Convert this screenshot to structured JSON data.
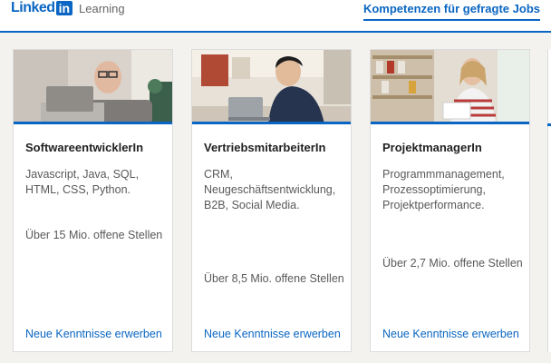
{
  "header": {
    "logo_text": "Linked",
    "logo_badge": "in",
    "product": "Learning",
    "nav_link": "Kompetenzen für gefragte Jobs",
    "accent_color": "#0a66c2"
  },
  "cards": [
    {
      "title": "SoftwareentwicklerIn",
      "skills": "Javascript, Java, SQL, HTML, CSS, Python.",
      "jobs": "Über 15 Mio. offene Stellen",
      "cta": "Neue Kenntnisse erwerben",
      "image": "person-at-laptop-photo"
    },
    {
      "title": "VertriebsmitarbeiterIn",
      "skills": "CRM, Neugeschäftsentwicklung, B2B, Social Media.",
      "jobs": "Über 8,5 Mio. offene Stellen",
      "cta": "Neue Kenntnisse erwerben",
      "image": "person-on-phone-photo"
    },
    {
      "title": "ProjektmanagerIn",
      "skills": "Programmmanagement, Prozessoptimierung, Projektperformance.",
      "jobs": "Über 2,7 Mio. offene Stellen",
      "cta": "Neue Kenntnisse erwerben",
      "image": "person-reading-photo"
    }
  ]
}
